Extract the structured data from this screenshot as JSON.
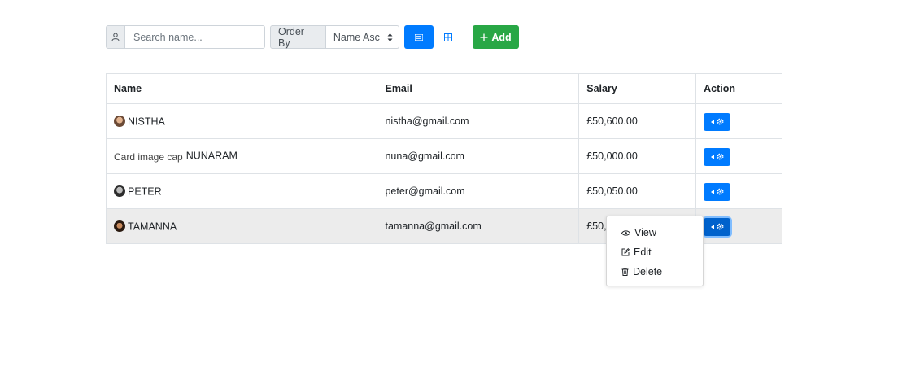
{
  "toolbar": {
    "search_placeholder": "Search name...",
    "search_value": "",
    "order_label": "Order By",
    "order_selected": "Name Asc",
    "add_label": "Add",
    "icons": {
      "search_prefix": "user-icon",
      "list_view": "list-icon",
      "grid_view": "grid-icon",
      "add": "plus-icon",
      "select_caret": "sort-caret-icon"
    }
  },
  "table": {
    "headers": [
      "Name",
      "Email",
      "Salary",
      "Action"
    ],
    "rows": [
      {
        "name": "NISTHA",
        "email": "nistha@gmail.com",
        "salary": "£50,600.00"
      },
      {
        "name": "NUNARAM",
        "avatar_alt": "Card image cap",
        "email": "nuna@gmail.com",
        "salary": "£50,000.00"
      },
      {
        "name": "PETER",
        "email": "peter@gmail.com",
        "salary": "£50,050.00"
      },
      {
        "name": "TAMANNA",
        "email": "tamanna@gmail.com",
        "salary": "£50,0"
      }
    ]
  },
  "action_menu": {
    "items": [
      {
        "label": "View",
        "icon": "eye-icon"
      },
      {
        "label": "Edit",
        "icon": "edit-icon"
      },
      {
        "label": "Delete",
        "icon": "trash-icon"
      }
    ]
  },
  "colors": {
    "primary": "#007bff",
    "success": "#28a745",
    "row_highlight": "#ececec"
  }
}
